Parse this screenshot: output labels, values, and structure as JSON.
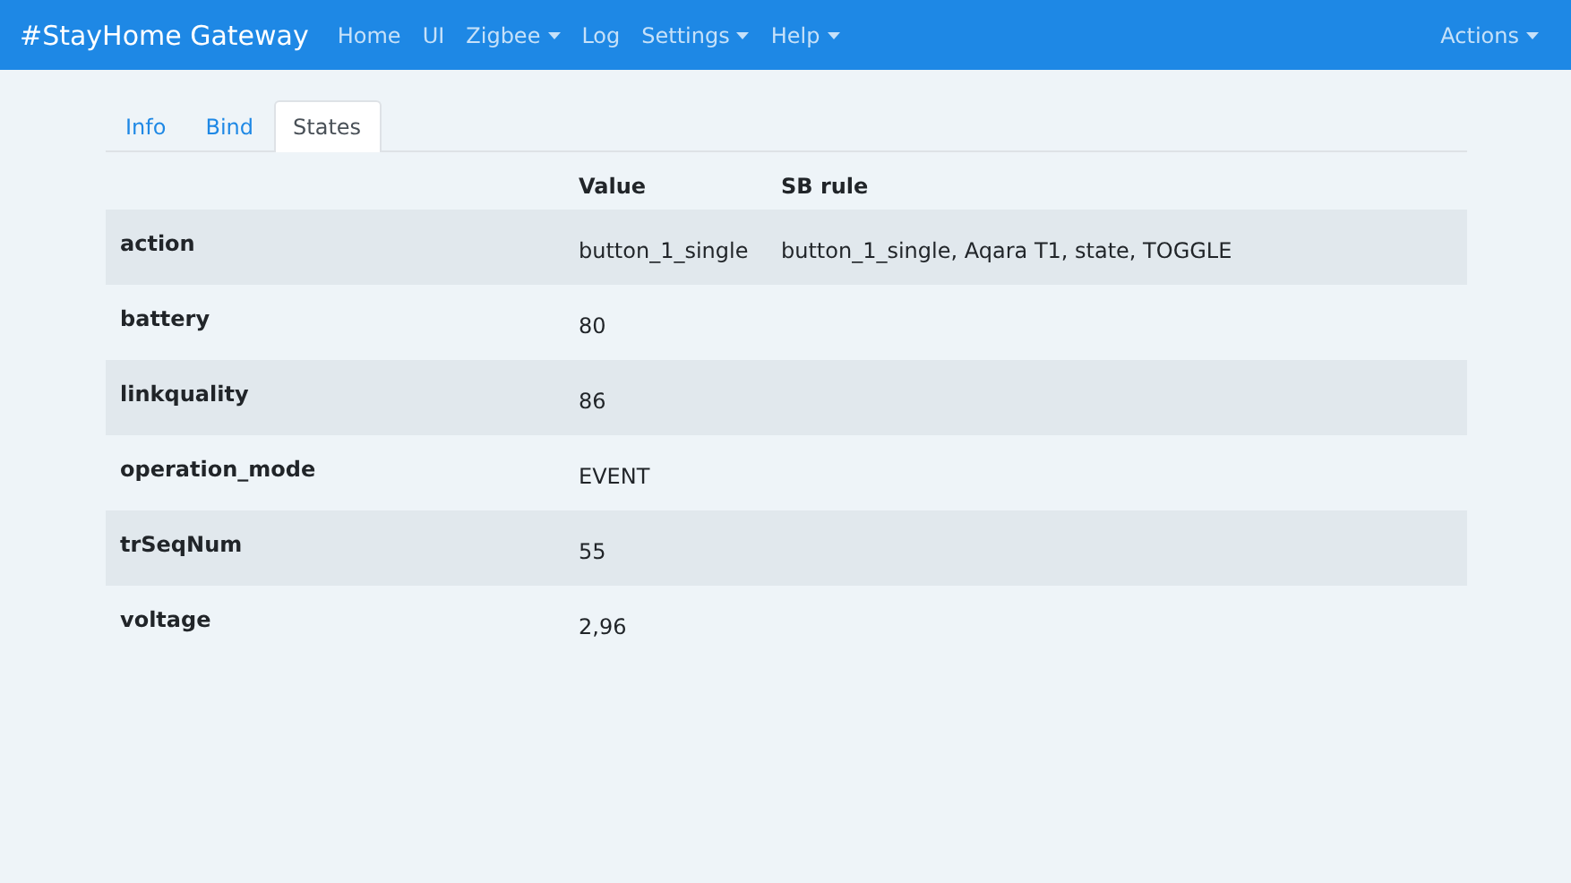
{
  "navbar": {
    "brand": "#StayHome Gateway",
    "items": [
      {
        "label": "Home",
        "dropdown": false
      },
      {
        "label": "UI",
        "dropdown": false
      },
      {
        "label": "Zigbee",
        "dropdown": true
      },
      {
        "label": "Log",
        "dropdown": false
      },
      {
        "label": "Settings",
        "dropdown": true
      },
      {
        "label": "Help",
        "dropdown": true
      }
    ],
    "right_items": [
      {
        "label": "Actions",
        "dropdown": true
      }
    ]
  },
  "tabs": [
    {
      "label": "Info",
      "selected": false
    },
    {
      "label": "Bind",
      "selected": false
    },
    {
      "label": "States",
      "selected": true
    }
  ],
  "table": {
    "columns": [
      "Value",
      "SB rule"
    ],
    "rows": [
      {
        "name": "action",
        "value": "button_1_single",
        "sb_rule": "button_1_single, Aqara T1, state, TOGGLE"
      },
      {
        "name": "battery",
        "value": "80"
      },
      {
        "name": "linkquality",
        "value": "86"
      },
      {
        "name": "operation_mode",
        "value": "EVENT"
      },
      {
        "name": "trSeqNum",
        "value": "55"
      },
      {
        "name": "voltage",
        "value": "2,96"
      }
    ]
  }
}
